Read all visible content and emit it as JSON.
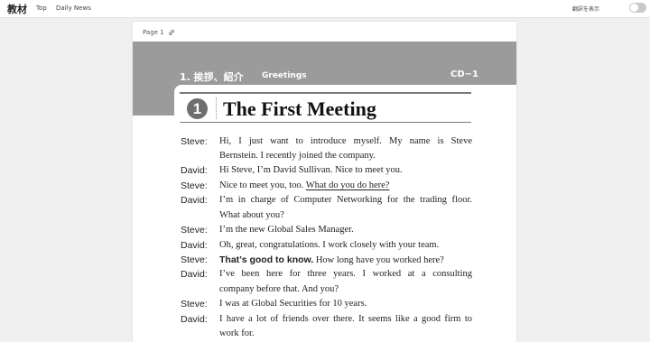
{
  "header": {
    "app_title": "教材",
    "nav": [
      "Top",
      "Daily News"
    ],
    "translate_label": "翻訳を表示"
  },
  "page": {
    "label": "Page 1",
    "lesson_heading": "1.  挨拶、紹介",
    "lesson_subtitle": "Greetings",
    "cd_label": "CD−1",
    "unit_number": "1",
    "title": "The First Meeting",
    "dialogue": [
      {
        "speaker": "Steve:",
        "lines": [
          "Hi, I just want to introduce myself. My name is Steve",
          "Bernstein. I recently joined the company."
        ]
      },
      {
        "speaker": "David:",
        "lines": [
          "Hi Steve, I’m David Sullivan. Nice to meet you."
        ]
      },
      {
        "speaker": "Steve:",
        "lines": [
          "Nice to meet you, too. "
        ],
        "underlined": "What do you do here?"
      },
      {
        "speaker": "David:",
        "lines": [
          "I’m in charge of Computer Networking for the trading floor.",
          "What about you?"
        ]
      },
      {
        "speaker": "Steve:",
        "lines": [
          "I’m the new Global Sales Manager."
        ]
      },
      {
        "speaker": "David:",
        "lines": [
          "Oh, great, congratulations. I work closely with your team."
        ]
      },
      {
        "speaker": "Steve:",
        "bold_phrase": "That’s good to know.",
        "lines": [
          " How long have you worked here?"
        ]
      },
      {
        "speaker": "David:",
        "lines": [
          "I’ve been here for three years. I worked at a consulting",
          "company before that. And you?"
        ]
      },
      {
        "speaker": "Steve:",
        "lines": [
          "I was at Global Securities for 10 years."
        ]
      },
      {
        "speaker": "David:",
        "lines": [
          "I have a lot of friends over there. It seems like a good firm to",
          "work for."
        ]
      }
    ]
  }
}
